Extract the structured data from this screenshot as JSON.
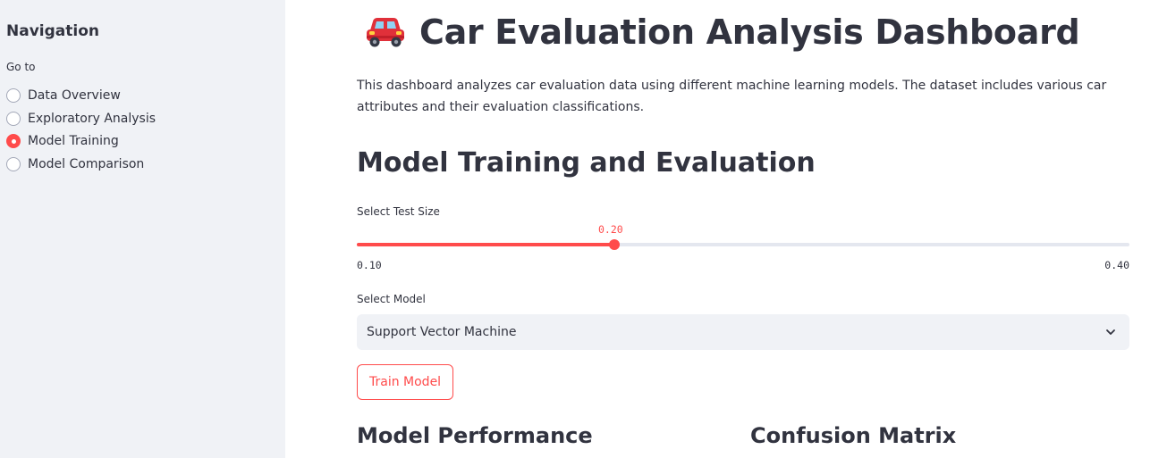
{
  "sidebar": {
    "title": "Navigation",
    "goto_label": "Go to",
    "items": [
      {
        "label": "Data Overview",
        "selected": false
      },
      {
        "label": "Exploratory Analysis",
        "selected": false
      },
      {
        "label": "Model Training",
        "selected": true
      },
      {
        "label": "Model Comparison",
        "selected": false
      }
    ]
  },
  "header": {
    "icon": "red-car-icon",
    "title": "Car Evaluation Analysis Dashboard",
    "intro": "This dashboard analyzes car evaluation data using different machine learning models. The dataset includes various car attributes and their evaluation classifications."
  },
  "training": {
    "section_title": "Model Training and Evaluation",
    "slider": {
      "label": "Select Test Size",
      "value": "0.20",
      "min": "0.10",
      "max": "0.40",
      "fraction": 0.333
    },
    "select": {
      "label": "Select Model",
      "value": "Support Vector Machine"
    },
    "button_label": "Train Model",
    "performance_title": "Model Performance",
    "confusion_title": "Confusion Matrix"
  },
  "colors": {
    "accent": "#ff4b4b",
    "sidebar_bg": "#f0f2f6",
    "text": "#31333f"
  }
}
